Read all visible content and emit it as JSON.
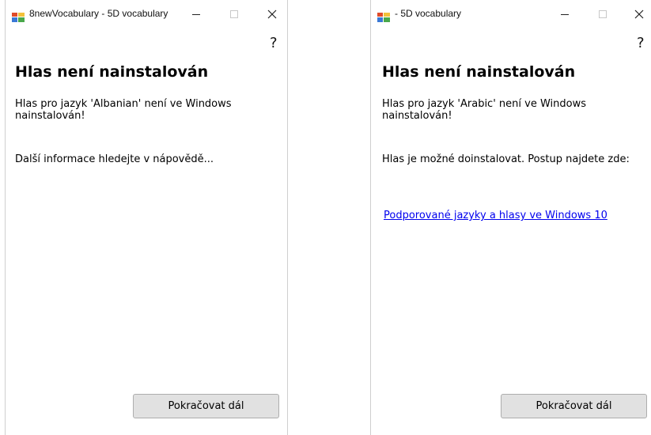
{
  "left_window": {
    "title": "8newVocabulary - 5D vocabulary",
    "help": "?",
    "heading": "Hlas není nainstalován",
    "message": "Hlas pro jazyk 'Albanian' není ve Windows nainstalován!",
    "info": "Další informace hledejte v nápovědě...",
    "continue_button": "Pokračovat dál"
  },
  "right_window": {
    "title": "- 5D vocabulary",
    "help": "?",
    "heading": "Hlas není nainstalován",
    "message": "Hlas pro jazyk 'Arabic' není ve Windows nainstalován!",
    "info": "Hlas je možné doinstalovat. Postup najdete zde:",
    "link": "Podporované jazyky a hlasy ve Windows 10",
    "continue_button": "Pokračovat dál"
  },
  "icons": {
    "app": "app-window-icon",
    "minimize": "minimize-icon",
    "maximize": "maximize-icon",
    "close": "close-icon"
  },
  "colors": {
    "link": "#0000ee",
    "button_bg": "#e1e1e1",
    "button_border": "#adadad"
  }
}
